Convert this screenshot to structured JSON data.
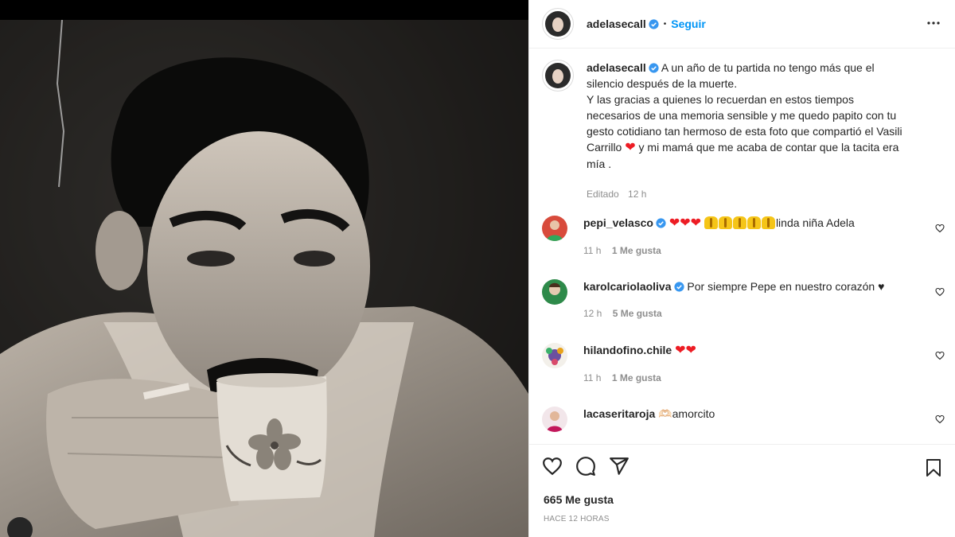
{
  "post": {
    "username": "adelasecall",
    "verified": true,
    "follow_label": "Seguir",
    "separator": "•",
    "caption_lines": [
      "A un año de tu partida no tengo más que el silencio después de la muerte.",
      "Y las gracias a quienes lo recuerdan en estos tiempos necesarios de una memoria sensible y me quedo papito con tu gesto cotidiano tan hermoso de esta foto que compartió el Vasili Carrillo",
      "y mi mamá que me acaba de contar que la tacita era mía ."
    ],
    "caption_meta": {
      "edited": "Editado",
      "time": "12 h"
    }
  },
  "comments": [
    {
      "username": "pepi_velasco",
      "verified": true,
      "text": "linda niña Adela",
      "hearts": 3,
      "pray": 5,
      "time": "11 h",
      "likes": "1 Me gusta"
    },
    {
      "username": "karolcariolaoliva",
      "verified": true,
      "text": "Por siempre Pepe en nuestro corazón ♥",
      "time": "12 h",
      "likes": "5 Me gusta"
    },
    {
      "username": "hilandofino.chile",
      "verified": false,
      "text": "",
      "hearts": 2,
      "time": "11 h",
      "likes": "1 Me gusta"
    },
    {
      "username": "lacaseritaroja",
      "verified": false,
      "text": "🫶🏻amorcito",
      "time": "",
      "likes": ""
    }
  ],
  "actions": {
    "likes_count": "665 Me gusta",
    "posted_ago": "HACE 12 HORAS"
  },
  "icons": [
    "heart-icon",
    "comment-icon",
    "share-icon",
    "bookmark-icon",
    "more-options-icon",
    "verified-icon",
    "user-tag-icon"
  ],
  "colors": {
    "link_blue": "#0095f6",
    "verified_blue": "#3897f0",
    "meta_gray": "#8e8e8e",
    "heart_red": "#ed1c24"
  }
}
